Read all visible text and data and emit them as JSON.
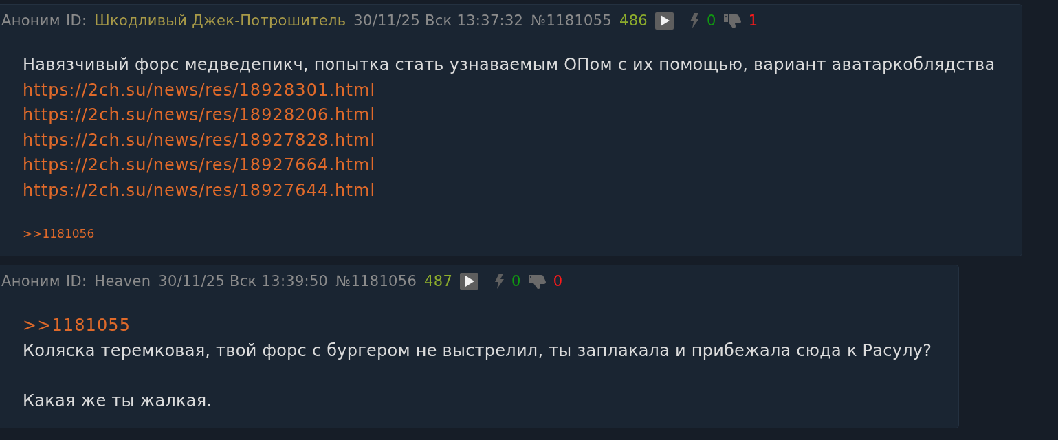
{
  "posts": [
    {
      "author": "Аноним",
      "id": {
        "label": "ID:",
        "name": "Шкодливый Джек-Потрошитель",
        "color": "#a89a48"
      },
      "date": "30/11/25 Вск 13:37:32",
      "number": "№1181055",
      "ordinal": "486",
      "likes": "0",
      "dislikes": "1",
      "paragraphs": [
        [
          {
            "kind": "text",
            "text": "Навязчивый форс медведепикч, попытка стать узнаваемым ОПом с их помощью, вариант аватаркоблядства"
          },
          {
            "kind": "link",
            "text": "https://2ch.su/news/res/18928301.html"
          },
          {
            "kind": "link",
            "text": "https://2ch.su/news/res/18928206.html"
          },
          {
            "kind": "link",
            "text": "https://2ch.su/news/res/18927828.html"
          },
          {
            "kind": "link",
            "text": "https://2ch.su/news/res/18927664.html"
          },
          {
            "kind": "link",
            "text": "https://2ch.su/news/res/18927644.html"
          }
        ]
      ],
      "replies": [
        ">>1181056"
      ]
    },
    {
      "author": "Аноним",
      "id": {
        "label": "ID:",
        "name": "Heaven",
        "color": "#8b8b8b"
      },
      "date": "30/11/25 Вск 13:39:50",
      "number": "№1181056",
      "ordinal": "487",
      "likes": "0",
      "dislikes": "0",
      "paragraphs": [
        [
          {
            "kind": "link",
            "text": ">>1181055"
          },
          {
            "kind": "text",
            "text": "Коляска теремковая, твой форс с бургером не выстрелил, ты заплакала и прибежала сюда к Расулу?"
          }
        ],
        [
          {
            "kind": "text",
            "text": "Какая же ты жалкая."
          }
        ]
      ]
    }
  ]
}
